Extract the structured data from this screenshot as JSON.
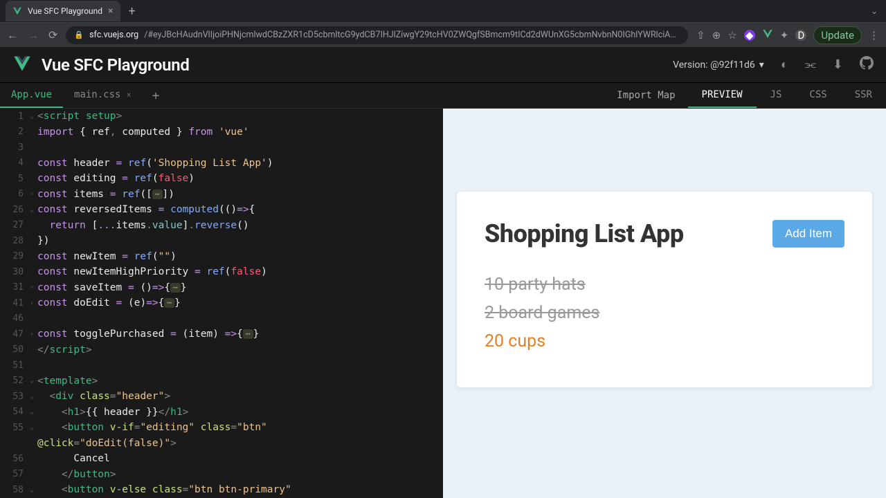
{
  "browser": {
    "tab_title": "Vue SFC Playground",
    "url_host": "sfc.vuejs.org",
    "url_path": "/#eyJBcHAudnVlIjoiPHNjcmlwdCBzZXR1cD5cbmltcG9ydCB7IHJlZiwgY29tcHV0ZWQgfSBmcm9tICd2dWUnXG5cbmNvbnN0IGhlYWRlciA9IHJlZignU2hvcHBpbmcgTGlzdCBBcHAnKVxuY29uc3QgZWRpdGluZyA9IHJlZihmYWxzZSlcbmNvbnN0IGl0ZW1zID0gcmVmKFtdKVxuY29uc3QgcmV2ZXJzZWRJdGVtcyA9IGNvbXB1dGVkKCgpPT57XG4gIHJldHVybiBbLi4uaXRlbXMudmFsdWVdLnJldmVyc2UoKVxufSlcbmNvbnN0IG5ld0l0ZW0gPSByZWYoXCJcIilcbmNvbnN0IG5ld0l0ZW1IaWdoUHJpb3JpdHkgPSByZWYoZmFsc2UpXG5jb25zdCBzYXZlSXRlbSA9ICgpPT57fVxuY29uc3QgZG9FZGl0ID0gKGUpPT57fVxuXG5jb25zdCB0b2dnbGVQdXJjaGFzZWQgPSAoaXRlbSkgPT57fVxuPC9zY3JpcHQ+XG5cbjx0ZW1wbGF0ZT5cbiAgPGRpdiBjbGFzcz1cImhlYWRlclwiPlxuICAgIDxo...",
    "update_label": "Update"
  },
  "header": {
    "title": "Vue SFC Playground",
    "version": "Version: @92f11d6"
  },
  "file_tabs": {
    "app": "App.vue",
    "css": "main.css"
  },
  "import_map": "Import Map",
  "out_tabs": {
    "preview": "PREVIEW",
    "js": "JS",
    "css": "CSS",
    "ssr": "SSR"
  },
  "code": {
    "l1_tag": "script",
    "l1_attr": "setup",
    "l2_import": "import",
    "l2_ref": "ref",
    "l2_computed": "computed",
    "l2_from": "from",
    "l2_vue": "'vue'",
    "l4_const": "const",
    "l4_header": "header",
    "l4_ref": "ref",
    "l4_str": "'Shopping List App'",
    "l5_editing": "editing",
    "l5_false": "false",
    "l6_items": "items",
    "l26_rev": "reversedItems",
    "l26_computed": "computed",
    "l27_return": "return",
    "l27_items": "items",
    "l27_value": "value",
    "l27_reverse": "reverse",
    "l29_newItem": "newItem",
    "l29_empty": "\"\"",
    "l30_newItemHP": "newItemHighPriority",
    "l31_saveItem": "saveItem",
    "l41_doEdit": "doEdit",
    "l47_toggle": "togglePurchased",
    "l47_item": "item",
    "l52_template": "template",
    "l53_div": "div",
    "l53_class": "class",
    "l53_header": "\"header\"",
    "l54_h1": "h1",
    "l54_expr": "{{ header }}",
    "l55_button": "button",
    "l55_vif": "v-if",
    "l55_editing": "\"editing\"",
    "l55_btn": "\"btn\"",
    "l55b_click": "@click",
    "l55b_doedit": "\"doEdit(false)\"",
    "l56_cancel": "Cancel",
    "l58_velse": "v-else",
    "l58_btnprim": "\"btn btn-primary\""
  },
  "preview": {
    "heading": "Shopping List App",
    "button": "Add Item",
    "items": [
      {
        "label": "10 party hats",
        "done": true,
        "priority": false
      },
      {
        "label": "2 board games",
        "done": true,
        "priority": false
      },
      {
        "label": "20 cups",
        "done": false,
        "priority": true
      }
    ]
  }
}
